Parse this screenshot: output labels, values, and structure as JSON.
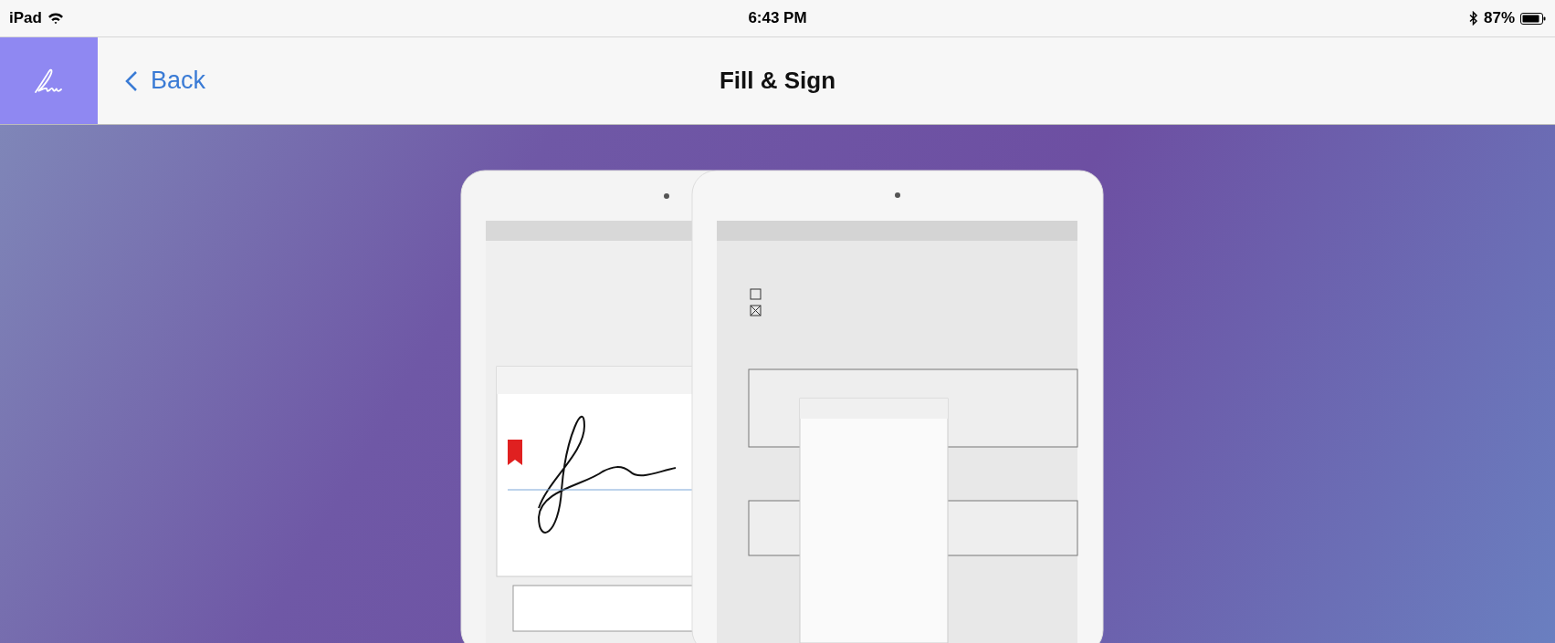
{
  "status_bar": {
    "device": "iPad",
    "time": "6:43 PM",
    "battery": "87%"
  },
  "nav_bar": {
    "back": "Back",
    "title": "Fill & Sign"
  }
}
